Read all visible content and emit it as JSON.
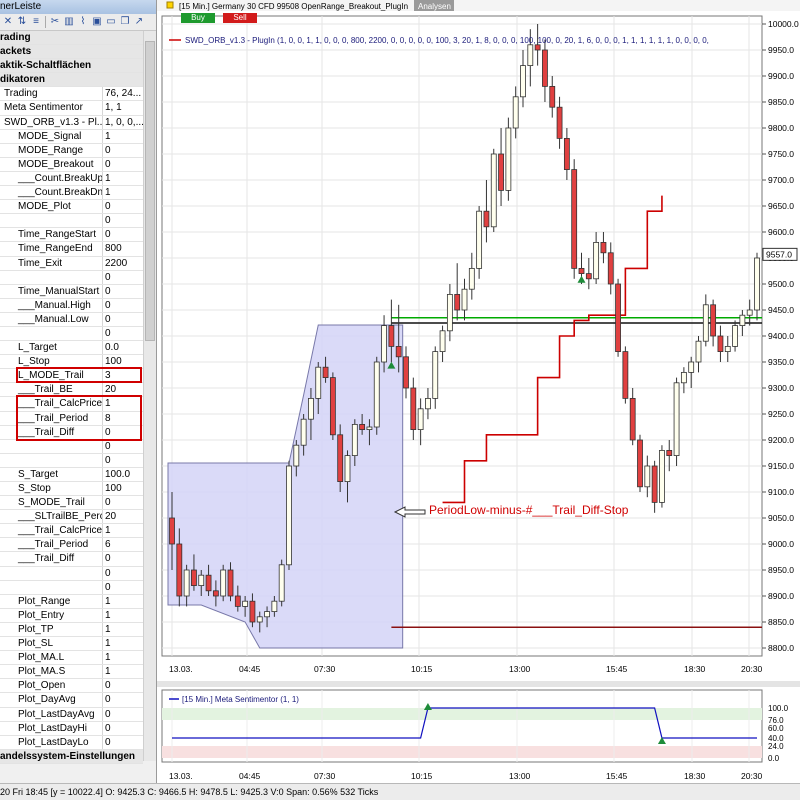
{
  "panel": {
    "title": "nerLeiste",
    "toolbar_icons": [
      "close-icon",
      "sort-icon",
      "list-icon",
      "cut-icon",
      "chart-icon",
      "chart-line-icon",
      "save-icon",
      "window-icon",
      "copy-icon",
      "chart-trend-icon"
    ],
    "categories": {
      "trading": "rading",
      "brackets": "ackets",
      "quick_buttons": "aktik-Schaltflächen",
      "indicators": "dikatoren",
      "trading_system": "andelssystem-Einstellungen"
    }
  },
  "properties": [
    {
      "name": "Trading",
      "value": "76, 24...",
      "indent": 0
    },
    {
      "name": "Meta Sentimentor",
      "value": "1, 1",
      "indent": 0
    },
    {
      "name": "SWD_ORB_v1.3 - Pl...",
      "value": "1, 0, 0,...",
      "indent": 0
    },
    {
      "name": "MODE_Signal",
      "value": "1",
      "indent": 1
    },
    {
      "name": "MODE_Range",
      "value": "0",
      "indent": 1
    },
    {
      "name": "MODE_Breakout",
      "value": "0",
      "indent": 1
    },
    {
      "name": "___Count.BreakUp",
      "value": "1",
      "indent": 1
    },
    {
      "name": "___Count.BreakDn",
      "value": "1",
      "indent": 1
    },
    {
      "name": "MODE_Plot",
      "value": "0",
      "indent": 1
    },
    {
      "name": "",
      "value": "0",
      "indent": 1
    },
    {
      "name": "Time_RangeStart",
      "value": "0",
      "indent": 1
    },
    {
      "name": "Time_RangeEnd",
      "value": "800",
      "indent": 1
    },
    {
      "name": "Time_Exit",
      "value": "2200",
      "indent": 1
    },
    {
      "name": "",
      "value": "0",
      "indent": 1
    },
    {
      "name": "Time_ManualStart",
      "value": "0",
      "indent": 1
    },
    {
      "name": "___Manual.High",
      "value": "0",
      "indent": 1
    },
    {
      "name": "___Manual.Low",
      "value": "0",
      "indent": 1
    },
    {
      "name": "",
      "value": "0",
      "indent": 1
    },
    {
      "name": "L_Target",
      "value": "0.0",
      "indent": 1
    },
    {
      "name": "L_Stop",
      "value": "100",
      "indent": 1
    },
    {
      "name": "L_MODE_Trail",
      "value": "3",
      "indent": 1
    },
    {
      "name": "___Trail_BE",
      "value": "20",
      "indent": 1
    },
    {
      "name": "___Trail_CalcPrice",
      "value": "1",
      "indent": 1
    },
    {
      "name": "___Trail_Period",
      "value": "8",
      "indent": 1
    },
    {
      "name": "___Trail_Diff",
      "value": "0",
      "indent": 1
    },
    {
      "name": "",
      "value": "0",
      "indent": 1
    },
    {
      "name": "",
      "value": "0",
      "indent": 1
    },
    {
      "name": "S_Target",
      "value": "100.0",
      "indent": 1
    },
    {
      "name": "S_Stop",
      "value": "100",
      "indent": 1
    },
    {
      "name": "S_MODE_Trail",
      "value": "0",
      "indent": 1
    },
    {
      "name": "___SLTrailBE_Perc",
      "value": "20",
      "indent": 1
    },
    {
      "name": "___Trail_CalcPrice",
      "value": "1",
      "indent": 1
    },
    {
      "name": "___Trail_Period",
      "value": "6",
      "indent": 1
    },
    {
      "name": "___Trail_Diff",
      "value": "0",
      "indent": 1
    },
    {
      "name": "",
      "value": "0",
      "indent": 1
    },
    {
      "name": "",
      "value": "0",
      "indent": 1
    },
    {
      "name": "Plot_Range",
      "value": "1",
      "indent": 1
    },
    {
      "name": "Plot_Entry",
      "value": "1",
      "indent": 1
    },
    {
      "name": "Plot_TP",
      "value": "1",
      "indent": 1
    },
    {
      "name": "Plot_SL",
      "value": "1",
      "indent": 1
    },
    {
      "name": "Plot_MA.L",
      "value": "1",
      "indent": 1
    },
    {
      "name": "Plot_MA.S",
      "value": "1",
      "indent": 1
    },
    {
      "name": "Plot_Open",
      "value": "0",
      "indent": 1
    },
    {
      "name": "Plot_DayAvg",
      "value": "0",
      "indent": 1
    },
    {
      "name": "Plot_LastDayAvg",
      "value": "0",
      "indent": 1
    },
    {
      "name": "Plot_LastDayHi",
      "value": "0",
      "indent": 1
    },
    {
      "name": "Plot_LastDayLo",
      "value": "0",
      "indent": 1
    }
  ],
  "chart": {
    "header": "[15 Min.] Germany 30 CFD   99508 OpenRange_Breakout_PlugIn",
    "analysis_tab": "Analysen",
    "buy_label": "Buy",
    "sell_label": "Sell",
    "indicator_label": "SWD_ORB_v1.3 - PlugIn  (1, 0, 0, 1, 1, 0, 0, 0, 800, 2200, 0, 0, 0, 0, 0, 100, 3, 20, 1, 8, 0, 0, 0, 100, 100, 0, 20, 1, 6, 0, 0, 0, 1, 1, 1, 1, 1, 1, 0, 0, 0, 0,",
    "annotation": "PeriodLow-minus-#___Trail_Diff-Stop",
    "price_labels": [
      "10000.0",
      "9950.0",
      "9900.0",
      "9850.0",
      "9800.0",
      "9750.0",
      "9700.0",
      "9650.0",
      "9600.0",
      "9550.0",
      "9500.0",
      "9450.0",
      "9400.0",
      "9350.0",
      "9300.0",
      "9250.0",
      "9200.0",
      "9150.0",
      "9100.0",
      "9050.0",
      "9000.0",
      "8950.0",
      "8900.0",
      "8850.0",
      "8800.0"
    ],
    "current_price": "9557.0",
    "time_labels": [
      "13.03.",
      "04:45",
      "07:30",
      "10:15",
      "13:00",
      "15:45",
      "18:30",
      "20:30"
    ],
    "colors": {
      "up": "#ffffee",
      "down": "#e04040",
      "trail": "#cc0000",
      "range_fill": "#d6d6f8",
      "entry_line": "#00aa00"
    }
  },
  "sub": {
    "label": "[15 Min.] Meta Sentimentor  (1, 1)",
    "axis_labels": [
      "100.0",
      "76.0",
      "60.0",
      "40.0",
      "24.0",
      "0.0"
    ],
    "current": "40.0",
    "time_labels": [
      "13.03.",
      "04:45",
      "07:30",
      "10:15",
      "13:00",
      "15:45",
      "18:30",
      "20:30"
    ]
  },
  "chart_data": {
    "type": "candlestick",
    "ylim": [
      8800,
      10000
    ],
    "candles": [
      [
        9050,
        9100,
        8950,
        9000
      ],
      [
        9000,
        9030,
        8880,
        8900
      ],
      [
        8900,
        8960,
        8880,
        8950
      ],
      [
        8950,
        8980,
        8910,
        8920
      ],
      [
        8920,
        8950,
        8900,
        8940
      ],
      [
        8940,
        8960,
        8900,
        8910
      ],
      [
        8910,
        8930,
        8880,
        8900
      ],
      [
        8900,
        8960,
        8890,
        8950
      ],
      [
        8950,
        8965,
        8890,
        8900
      ],
      [
        8900,
        8920,
        8870,
        8880
      ],
      [
        8880,
        8900,
        8860,
        8890
      ],
      [
        8890,
        8905,
        8840,
        8850
      ],
      [
        8850,
        8870,
        8830,
        8860
      ],
      [
        8860,
        8880,
        8840,
        8870
      ],
      [
        8870,
        8900,
        8860,
        8890
      ],
      [
        8890,
        8970,
        8880,
        8960
      ],
      [
        8960,
        9160,
        8950,
        9150
      ],
      [
        9150,
        9200,
        9130,
        9190
      ],
      [
        9190,
        9250,
        9170,
        9240
      ],
      [
        9240,
        9300,
        9200,
        9280
      ],
      [
        9280,
        9350,
        9250,
        9340
      ],
      [
        9340,
        9360,
        9310,
        9320
      ],
      [
        9320,
        9330,
        9200,
        9210
      ],
      [
        9210,
        9230,
        9100,
        9120
      ],
      [
        9120,
        9180,
        9080,
        9170
      ],
      [
        9170,
        9240,
        9150,
        9230
      ],
      [
        9230,
        9250,
        9210,
        9220
      ],
      [
        9220,
        9240,
        9190,
        9225
      ],
      [
        9225,
        9360,
        9210,
        9350
      ],
      [
        9350,
        9440,
        9330,
        9420
      ],
      [
        9420,
        9470,
        9350,
        9380
      ],
      [
        9380,
        9460,
        9330,
        9360
      ],
      [
        9360,
        9380,
        9280,
        9300
      ],
      [
        9300,
        9320,
        9200,
        9220
      ],
      [
        9220,
        9280,
        9190,
        9260
      ],
      [
        9260,
        9300,
        9240,
        9280
      ],
      [
        9280,
        9380,
        9260,
        9370
      ],
      [
        9370,
        9420,
        9350,
        9410
      ],
      [
        9410,
        9500,
        9390,
        9480
      ],
      [
        9480,
        9540,
        9430,
        9450
      ],
      [
        9450,
        9510,
        9430,
        9490
      ],
      [
        9490,
        9560,
        9470,
        9530
      ],
      [
        9530,
        9650,
        9510,
        9640
      ],
      [
        9640,
        9700,
        9580,
        9610
      ],
      [
        9610,
        9760,
        9600,
        9750
      ],
      [
        9750,
        9800,
        9650,
        9680
      ],
      [
        9680,
        9820,
        9660,
        9800
      ],
      [
        9800,
        9880,
        9780,
        9860
      ],
      [
        9860,
        9950,
        9840,
        9920
      ],
      [
        9920,
        9990,
        9880,
        9960
      ],
      [
        9960,
        10000,
        9920,
        9950
      ],
      [
        9950,
        9970,
        9850,
        9880
      ],
      [
        9880,
        9900,
        9820,
        9840
      ],
      [
        9840,
        9860,
        9760,
        9780
      ],
      [
        9780,
        9800,
        9700,
        9720
      ],
      [
        9720,
        9740,
        9510,
        9530
      ],
      [
        9530,
        9560,
        9500,
        9520
      ],
      [
        9520,
        9550,
        9490,
        9510
      ],
      [
        9510,
        9600,
        9500,
        9580
      ],
      [
        9580,
        9600,
        9540,
        9560
      ],
      [
        9560,
        9580,
        9480,
        9500
      ],
      [
        9500,
        9510,
        9360,
        9370
      ],
      [
        9370,
        9380,
        9270,
        9280
      ],
      [
        9280,
        9300,
        9190,
        9200
      ],
      [
        9200,
        9210,
        9100,
        9110
      ],
      [
        9110,
        9170,
        9090,
        9150
      ],
      [
        9150,
        9160,
        9060,
        9080
      ],
      [
        9080,
        9190,
        9070,
        9180
      ],
      [
        9180,
        9200,
        9140,
        9170
      ],
      [
        9170,
        9320,
        9150,
        9310
      ],
      [
        9310,
        9340,
        9290,
        9330
      ],
      [
        9330,
        9360,
        9300,
        9350
      ],
      [
        9350,
        9400,
        9330,
        9390
      ],
      [
        9390,
        9480,
        9380,
        9460
      ],
      [
        9460,
        9470,
        9380,
        9400
      ],
      [
        9400,
        9420,
        9350,
        9370
      ],
      [
        9370,
        9400,
        9350,
        9380
      ],
      [
        9380,
        9430,
        9370,
        9420
      ],
      [
        9420,
        9450,
        9400,
        9440
      ],
      [
        9440,
        9470,
        9420,
        9450
      ],
      [
        9450,
        9560,
        9430,
        9550
      ]
    ],
    "trail_stop": [
      [
        37,
        9080
      ],
      [
        39,
        9080
      ],
      [
        40,
        9160
      ],
      [
        42,
        9160
      ],
      [
        43,
        9210
      ],
      [
        48,
        9210
      ],
      [
        50,
        9320
      ],
      [
        53,
        9400
      ],
      [
        55,
        9430
      ],
      [
        57,
        9440
      ],
      [
        62,
        9530
      ],
      [
        65,
        9640
      ],
      [
        67,
        9670
      ]
    ],
    "range_high": 9435,
    "range_low": 8840,
    "entry_level": 9435,
    "entry_level_2": 9425,
    "sentimentor": {
      "ylim": [
        0,
        100
      ],
      "levels": [
        [
          0,
          40
        ],
        [
          34,
          40
        ],
        [
          35,
          100
        ],
        [
          66,
          100
        ],
        [
          67,
          40
        ],
        [
          80,
          40
        ]
      ]
    }
  }
}
